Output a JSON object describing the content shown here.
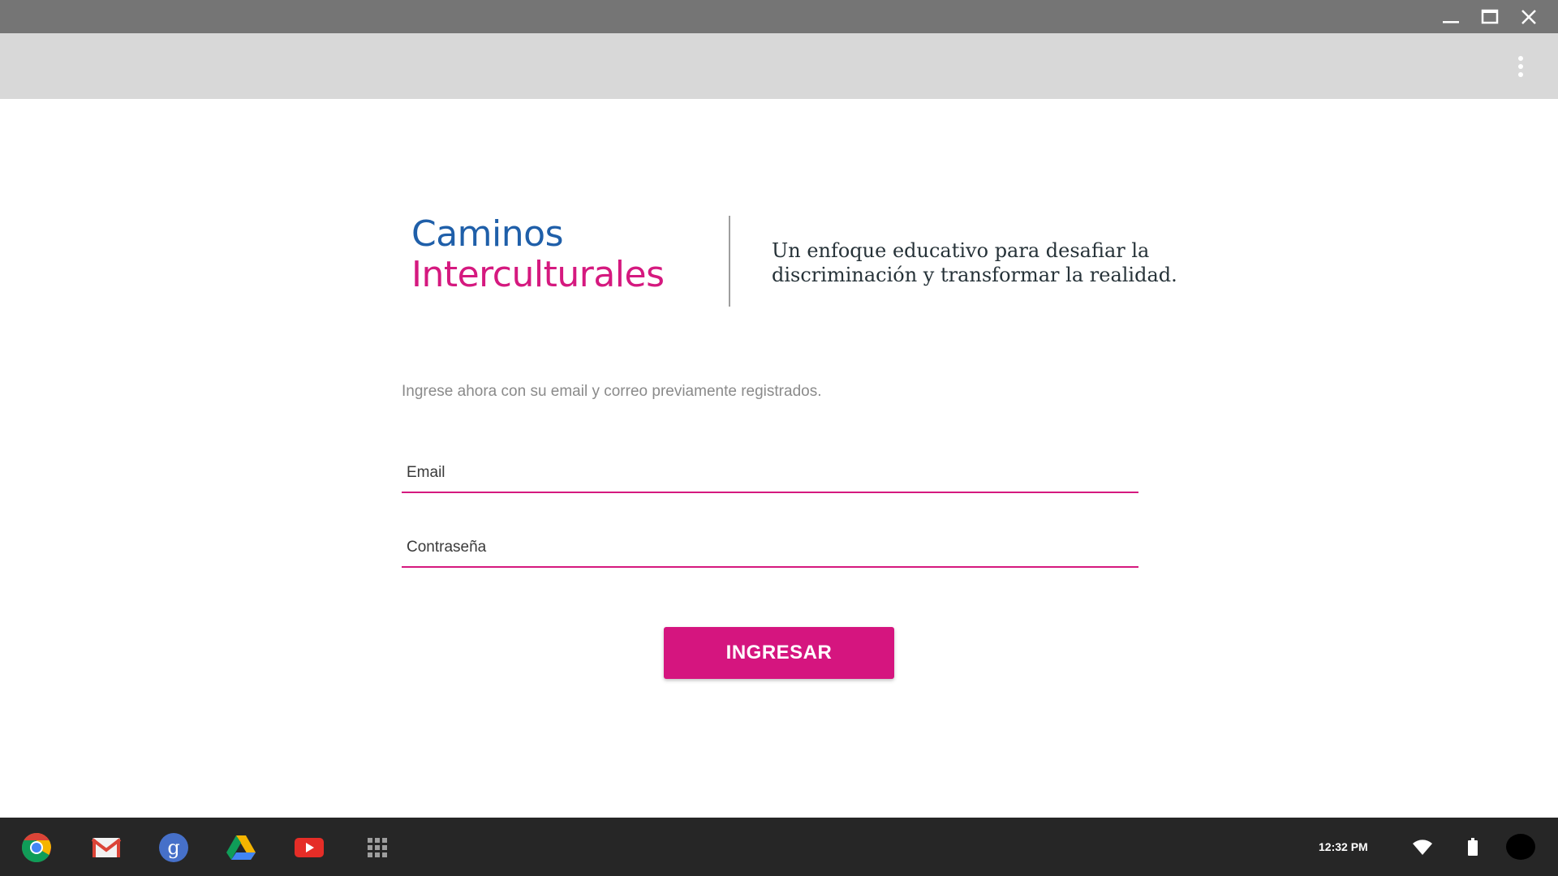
{
  "window": {
    "minimize_icon": "minimize-icon",
    "maximize_icon": "maximize-icon",
    "close_icon": "close-icon"
  },
  "toolbar": {
    "menu_icon": "more-vert-icon"
  },
  "brand": {
    "line1": "Caminos",
    "line2": "Interculturales",
    "line1_color": "#1f5fa9",
    "line2_color": "#d5197f",
    "tagline_line1": "Un enfoque educativo para desafiar la",
    "tagline_line2": "discriminación y transformar la realidad."
  },
  "login": {
    "intro": "Ingrese ahora con su email y correo previamente registrados.",
    "email_placeholder": "Email",
    "password_placeholder": "Contraseña",
    "submit_label": "INGRESAR",
    "accent_color": "#d5157f"
  },
  "shelf": {
    "apps": [
      "chrome-icon",
      "gmail-icon",
      "google-plus-icon",
      "drive-icon",
      "youtube-icon",
      "app-launcher-icon"
    ],
    "clock": "12:32 PM",
    "tray": [
      "wifi-icon",
      "battery-icon",
      "avatar"
    ]
  }
}
